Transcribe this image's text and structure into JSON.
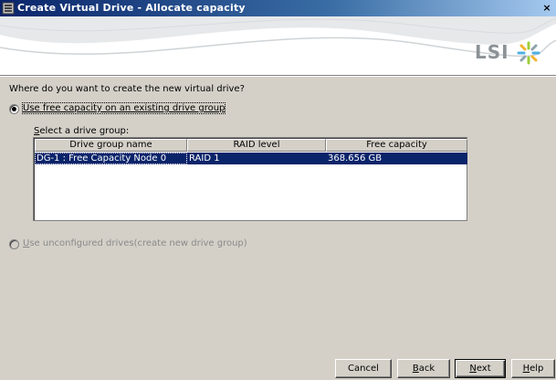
{
  "window": {
    "title": "Create Virtual Drive - Allocate capacity",
    "close_glyph": "×"
  },
  "banner": {
    "logo_text": "LSI"
  },
  "question": "Where do you want to create the new virtual drive?",
  "options": {
    "existing": {
      "label": "Use free capacity on an existing drive group",
      "selected": true
    },
    "unconfigured": {
      "label_u": "U",
      "label_rest": "se unconfigured drives(create new drive group)",
      "enabled": false
    }
  },
  "drive_group": {
    "select_label_u": "S",
    "select_label_rest": "elect a drive group:",
    "columns": [
      "Drive group name",
      "RAID level",
      "Free capacity"
    ],
    "rows": [
      {
        "name": "DG-1 : Free Capacity Node 0",
        "raid": "RAID 1",
        "capacity": "368.656 GB",
        "selected": true
      }
    ]
  },
  "buttons": {
    "cancel": "Cancel",
    "back_u": "B",
    "back_rest": "ack",
    "next_u": "N",
    "next_rest": "ext",
    "help_u": "H",
    "help_rest": "elp"
  },
  "colors": {
    "selection": "#0a246a",
    "dialog_bg": "#d4d0c8",
    "title_start": "#0a246a"
  }
}
